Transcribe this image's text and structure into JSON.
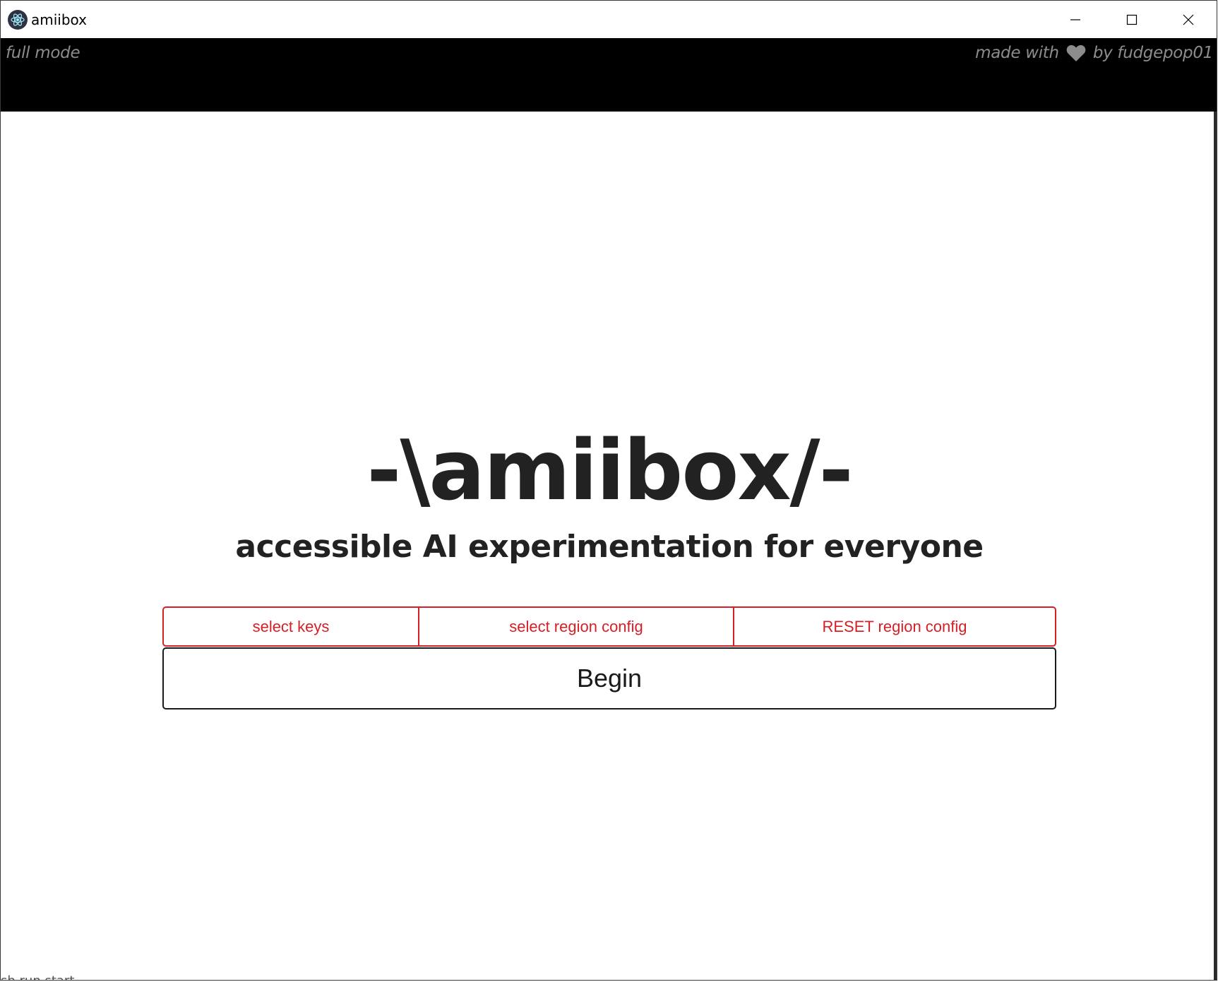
{
  "window": {
    "title": "amiibox",
    "controls": {
      "minimize_icon": "minimize-icon",
      "maximize_icon": "maximize-icon",
      "close_icon": "close-icon"
    }
  },
  "header": {
    "mode_label": "full mode",
    "credit_prefix": "made with",
    "credit_icon": "heart-icon",
    "credit_suffix": "by fudgepop01"
  },
  "hero": {
    "title": "-\\amiibox/-",
    "subtitle": "accessible AI experimentation for everyone"
  },
  "options": {
    "select_keys": "select keys",
    "select_region_config": "select region config",
    "reset_region_config": "RESET region config"
  },
  "begin_label": "Begin",
  "bottom_clipped_text": "sh run start",
  "colors": {
    "accent_red": "#d61f26",
    "header_bg": "#000000",
    "header_text": "#8c8c8c",
    "text_dark": "#222222"
  }
}
